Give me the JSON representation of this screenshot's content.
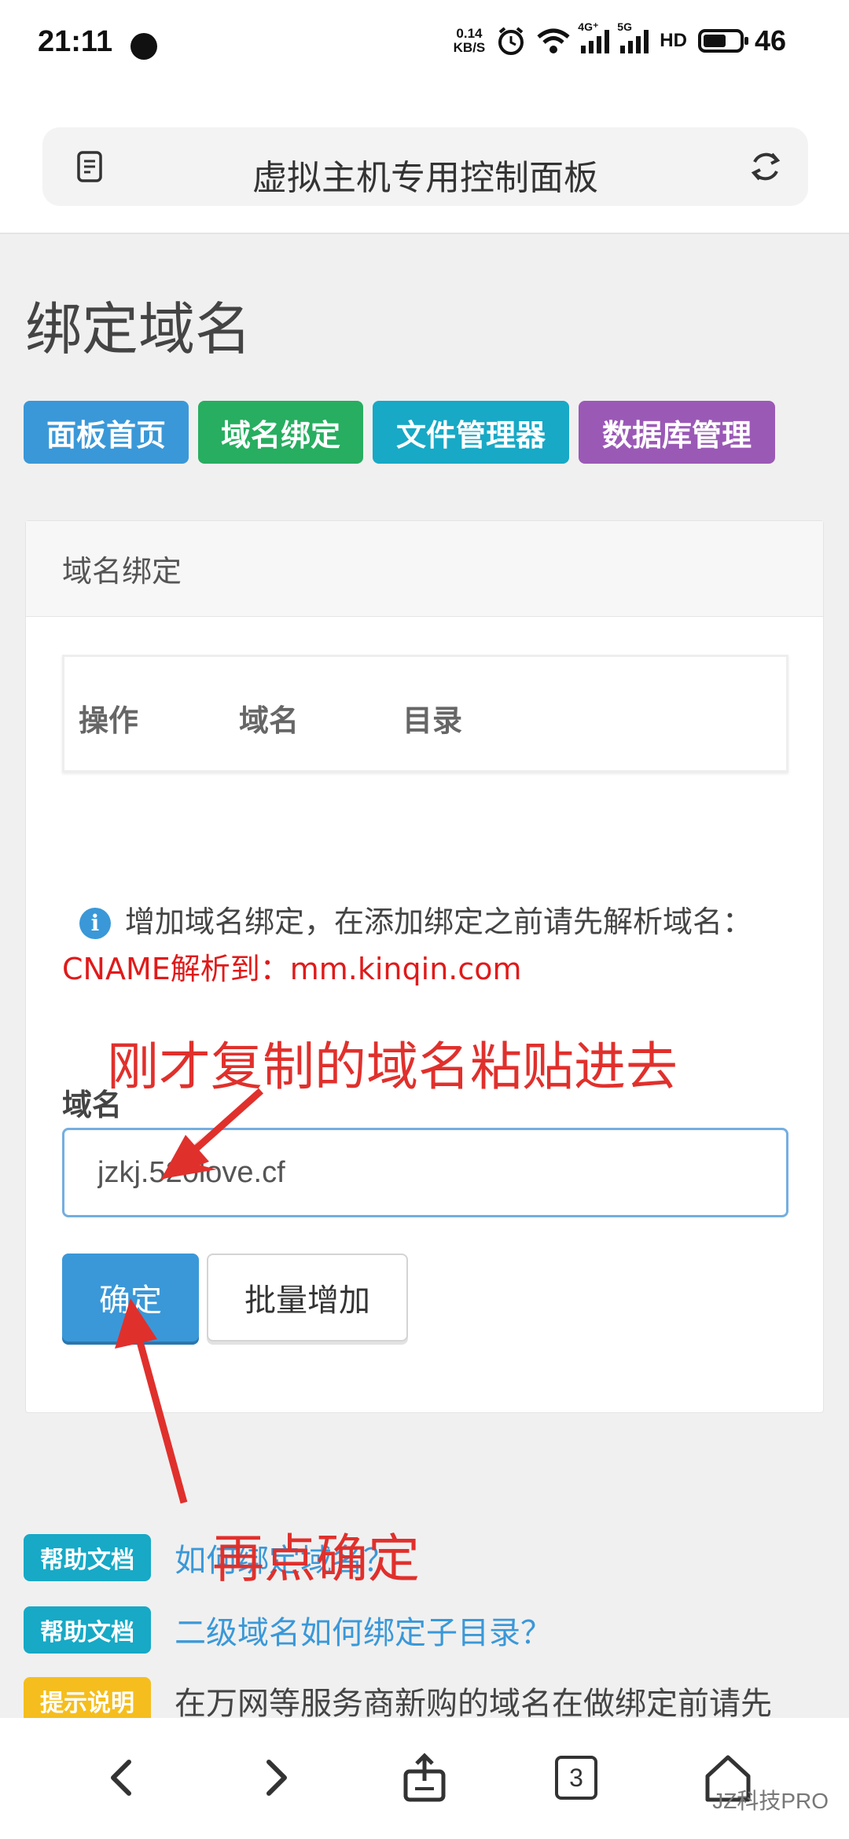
{
  "status_bar": {
    "time": "21:11",
    "speed_value": "0.14",
    "speed_unit": "KB/S",
    "net_4g": "4G⁺",
    "net_5g": "5G",
    "hd": "HD",
    "battery": "46"
  },
  "browser": {
    "title": "虚拟主机专用控制面板",
    "doc_icon": "document-icon",
    "reload_icon": "reload-icon"
  },
  "page": {
    "title": "绑定域名",
    "nav": [
      {
        "label": "面板首页",
        "color": "#3a98d8"
      },
      {
        "label": "域名绑定",
        "color": "#27ae60"
      },
      {
        "label": "文件管理器",
        "color": "#17a9c6"
      },
      {
        "label": "数据库管理",
        "color": "#9b59b6"
      }
    ]
  },
  "panel": {
    "heading": "域名绑定",
    "columns": [
      "操作",
      "域名",
      "目录"
    ],
    "notice_text": "增加域名绑定，在添加绑定之前请先解析域名：",
    "notice_red": "CNAME解析到：mm.kinqin.com",
    "field_label": "域名",
    "input_value": "jzkj.520love.cf",
    "confirm_label": "确定",
    "batch_label": "批量增加"
  },
  "help": [
    {
      "badge": "帮助文档",
      "text": "如何绑定域名？",
      "color": "#17a9c6"
    },
    {
      "badge": "帮助文档",
      "text": "二级域名如何绑定子目录？",
      "color": "#17a9c6"
    },
    {
      "badge": "提示说明",
      "text": "在万网等服务商新购的域名在做绑定前请先",
      "color": "#f5be1e"
    }
  ],
  "annotations": {
    "top": "刚才复制的域名粘贴进去",
    "bottom": "再点确定"
  },
  "bottom_nav": {
    "tab_count": "3",
    "watermark": "JZ科技PRO"
  }
}
